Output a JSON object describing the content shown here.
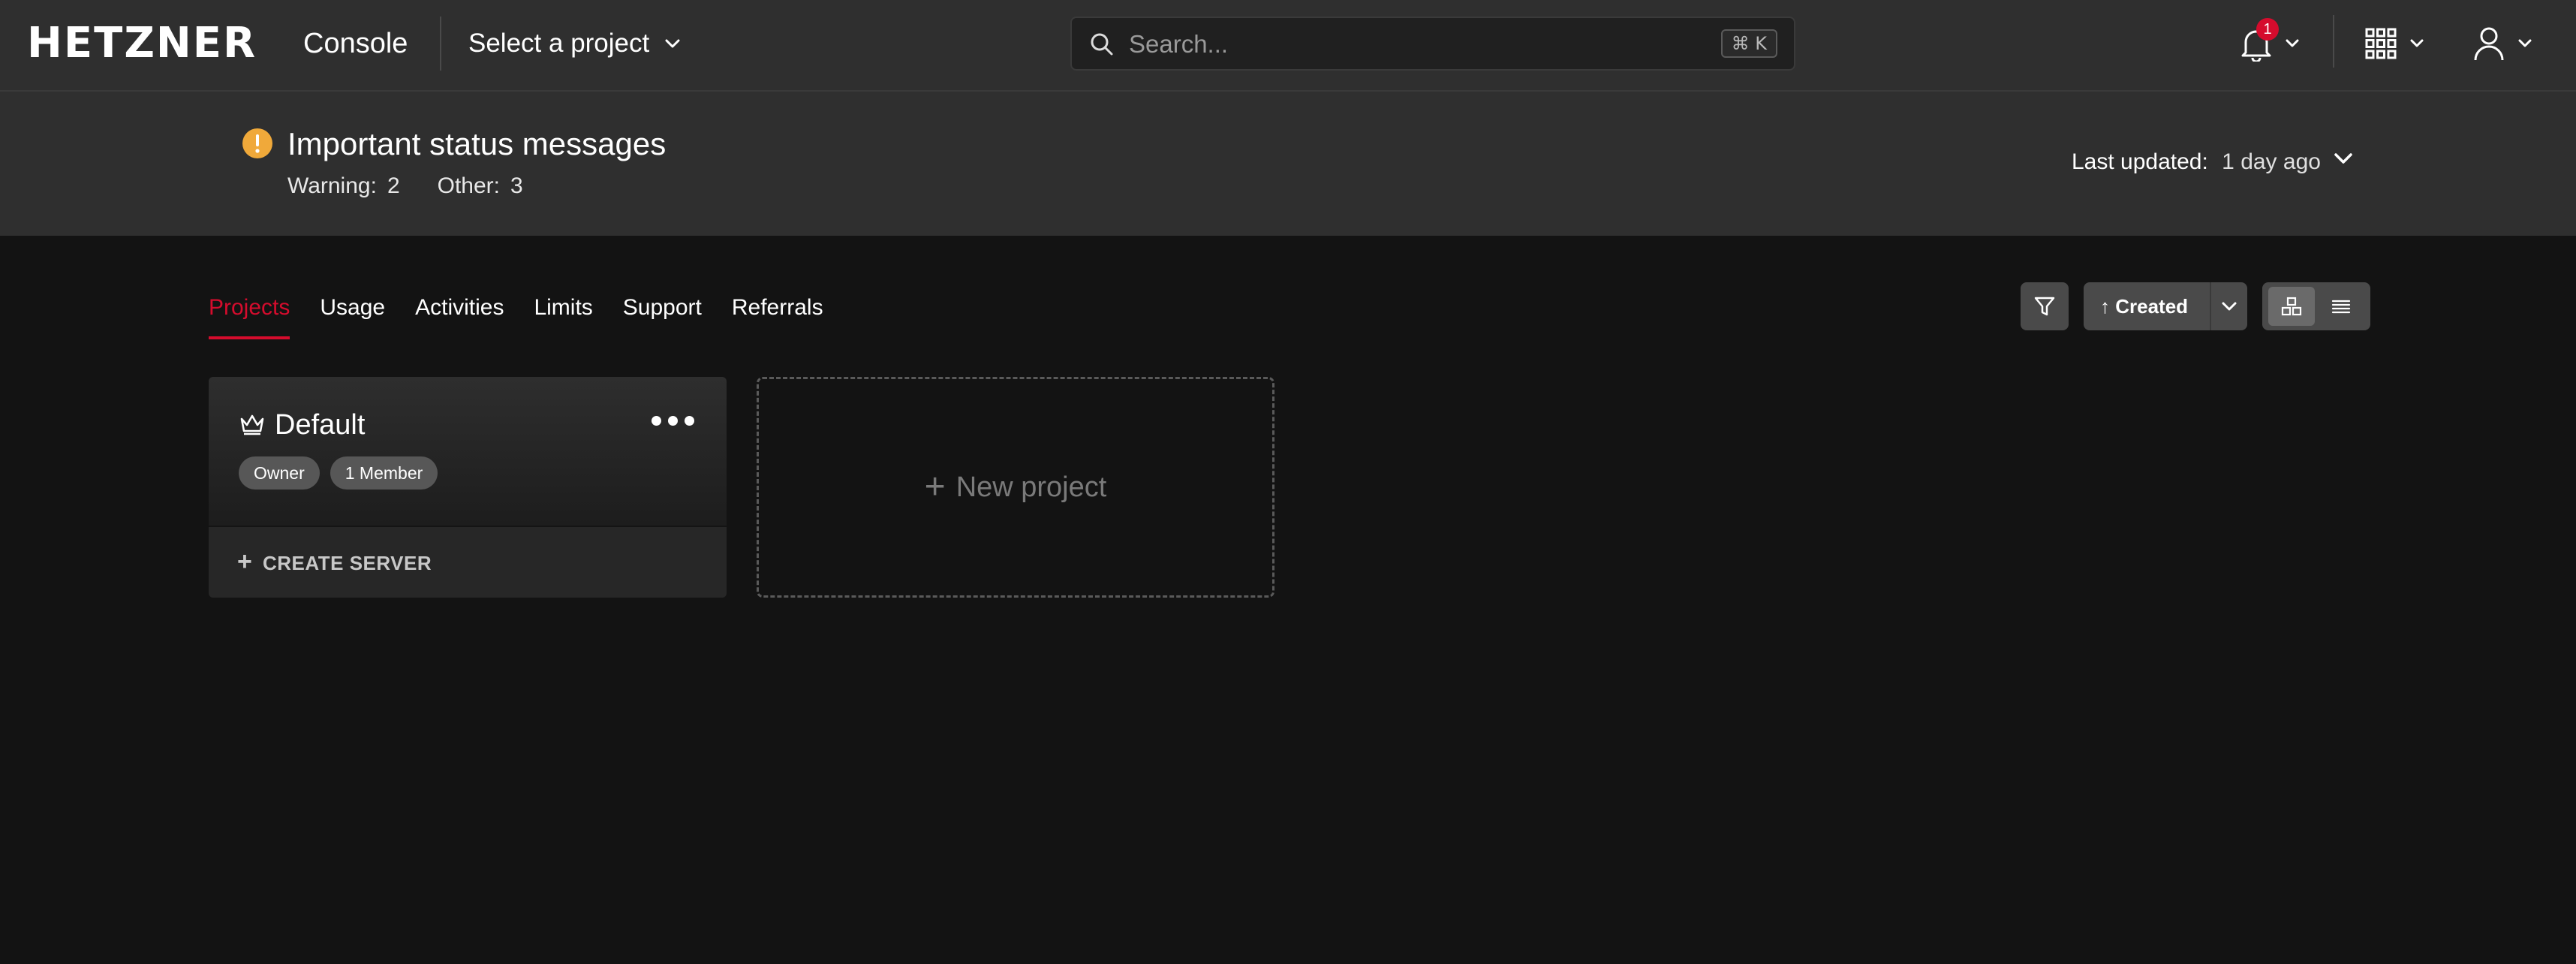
{
  "topbar": {
    "logo": "HETZNER",
    "app_name": "Console",
    "project_select_label": "Select a project",
    "search_placeholder": "Search...",
    "search_shortcut": "⌘ K",
    "notification_count": "1"
  },
  "status": {
    "title": "Important status messages",
    "warning_label": "Warning:",
    "warning_count": "2",
    "other_label": "Other:",
    "other_count": "3",
    "last_updated_label": "Last updated:",
    "last_updated_value": "1 day ago"
  },
  "tabs": [
    {
      "label": "Projects",
      "active": true
    },
    {
      "label": "Usage"
    },
    {
      "label": "Activities"
    },
    {
      "label": "Limits"
    },
    {
      "label": "Support"
    },
    {
      "label": "Referrals"
    }
  ],
  "toolbar": {
    "sort_label": "↑ Created",
    "view_modes": [
      "grid-icon",
      "list-icon"
    ]
  },
  "projects": [
    {
      "name": "Default",
      "role": "Owner",
      "members": "1 Member",
      "create_server": "CREATE SERVER"
    }
  ],
  "new_project": {
    "label": "New project"
  },
  "colors": {
    "accent": "#d50c2d",
    "topbar_bg": "#2f2f2f",
    "page_bg": "#131313",
    "warning": "#f0a93a"
  }
}
